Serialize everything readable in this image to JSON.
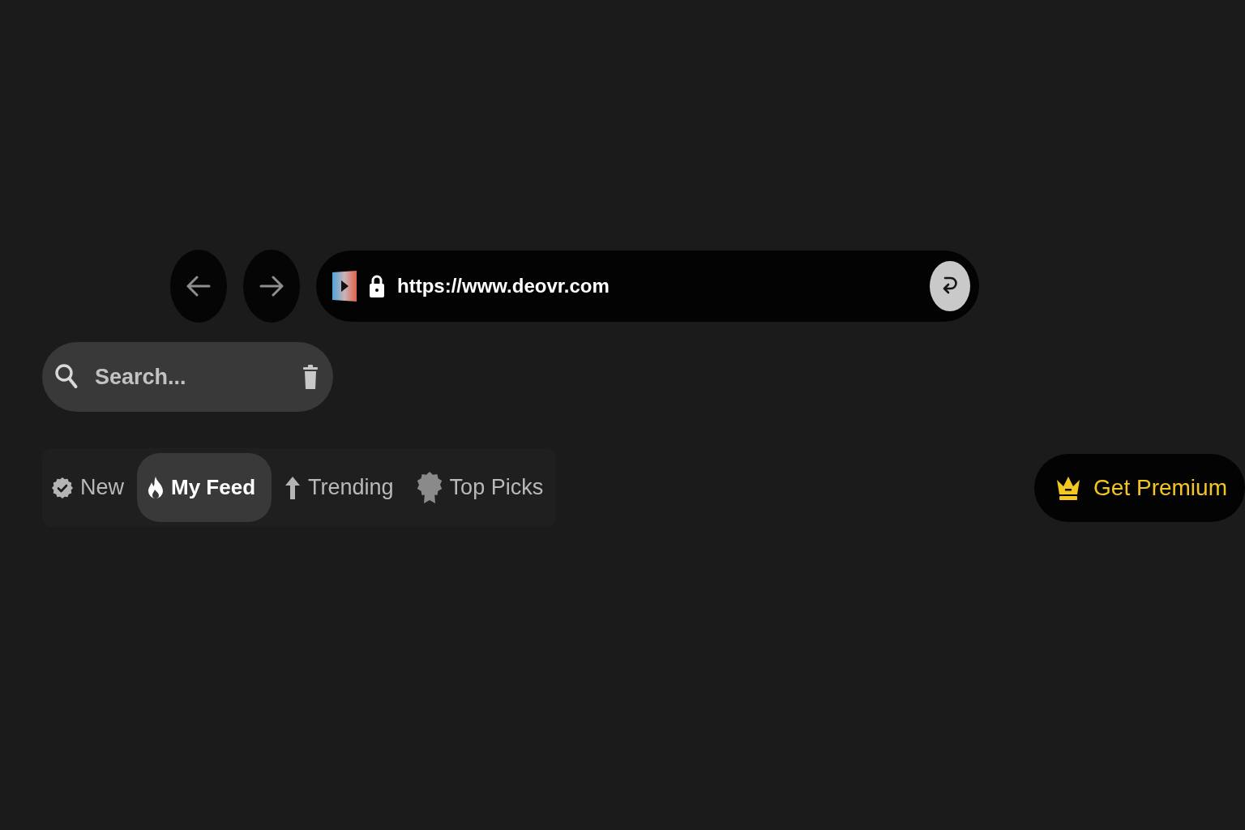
{
  "address_bar": {
    "url": "https://www.deovr.com"
  },
  "search": {
    "placeholder": "Search..."
  },
  "tabs": [
    {
      "label": "New",
      "selected": false
    },
    {
      "label": "My Feed",
      "selected": true
    },
    {
      "label": "Trending",
      "selected": false
    },
    {
      "label": "Top Picks",
      "selected": false
    }
  ],
  "premium_button": {
    "label": "Get Premium"
  }
}
